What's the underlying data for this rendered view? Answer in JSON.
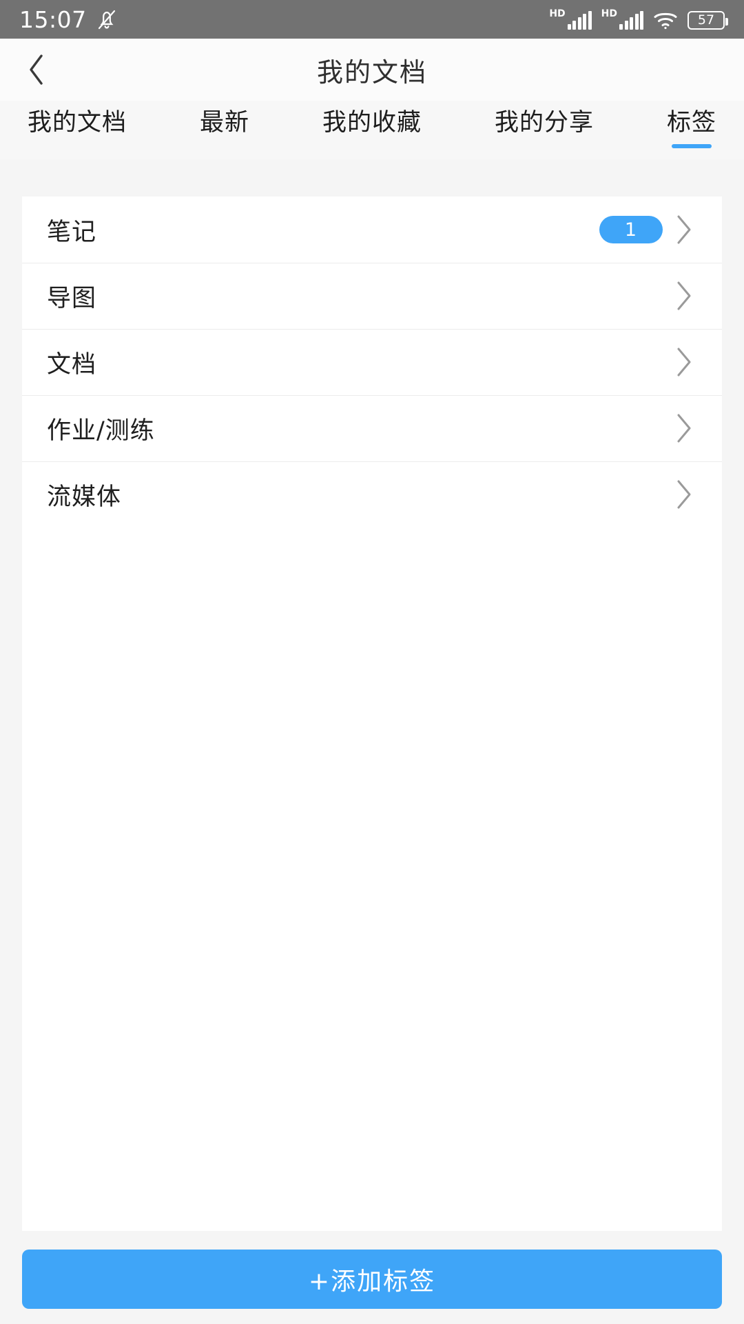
{
  "statusbar": {
    "time": "15:07",
    "mute_icon": "bell-muted-icon",
    "hd_label_1": "HD",
    "hd_label_2": "HD",
    "wifi_icon": "wifi-icon",
    "battery_level": "57"
  },
  "header": {
    "back_icon": "chevron-left-icon",
    "title": "我的文档"
  },
  "tabs": [
    {
      "label": "我的文档",
      "active": false
    },
    {
      "label": "最新",
      "active": false
    },
    {
      "label": "我的收藏",
      "active": false
    },
    {
      "label": "我的分享",
      "active": false
    },
    {
      "label": "标签",
      "active": true
    }
  ],
  "list": [
    {
      "label": "笔记",
      "count": "1",
      "chevron": "chevron-right-icon"
    },
    {
      "label": "导图",
      "count": "",
      "chevron": "chevron-right-icon"
    },
    {
      "label": "文档",
      "count": "",
      "chevron": "chevron-right-icon"
    },
    {
      "label": "作业/测练",
      "count": "",
      "chevron": "chevron-right-icon"
    },
    {
      "label": "流媒体",
      "count": "",
      "chevron": "chevron-right-icon"
    }
  ],
  "footer": {
    "add_label": "+添加标签"
  },
  "colors": {
    "accent": "#3fa5f8",
    "statusbar_bg": "#727272",
    "page_bg": "#f5f5f5",
    "card_bg": "#ffffff",
    "text_primary": "#1f1f1f",
    "chevron_gray": "#9a9a9a"
  }
}
